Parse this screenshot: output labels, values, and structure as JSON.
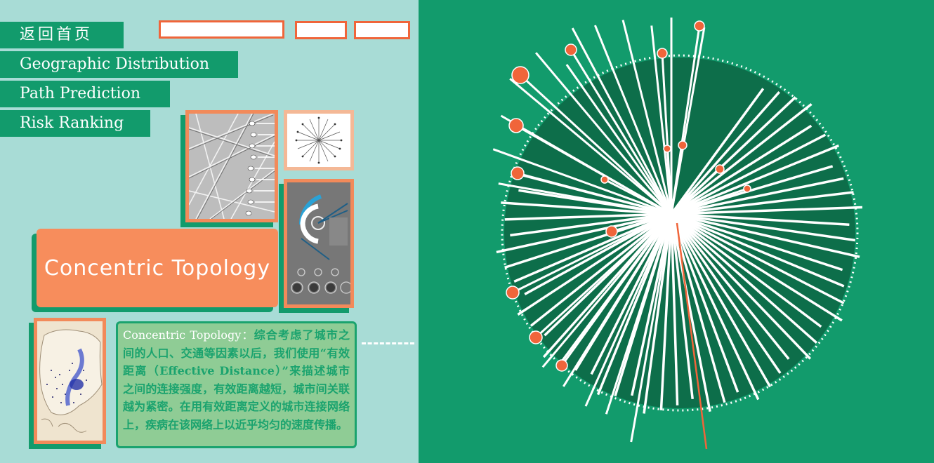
{
  "nav": {
    "items": [
      {
        "label": "返回首页"
      },
      {
        "label": "Geographic Distribution"
      },
      {
        "label": "Path Prediction"
      },
      {
        "label": "Risk Ranking"
      }
    ]
  },
  "title_card": {
    "label": "Concentric Topology"
  },
  "description": {
    "lead": "Concentric Topology：",
    "text": "综合考虑了城市之间的人口、交通等因素以后，我们使用“有效距离（Effective Distance）”来描述城市之间的连接强度，有效距离越短，城市间关联越为紧密。在用有效距离定义的城市连接网络上，疾病在该网络上以近乎均匀的速度传播。"
  },
  "colors": {
    "panel_left": "#a8dcd6",
    "panel_right": "#129b6c",
    "dark_green": "#0d6e4a",
    "accent_orange": "#f0653a",
    "card_orange": "#f78d5c",
    "card_green": "#8fcc95"
  }
}
